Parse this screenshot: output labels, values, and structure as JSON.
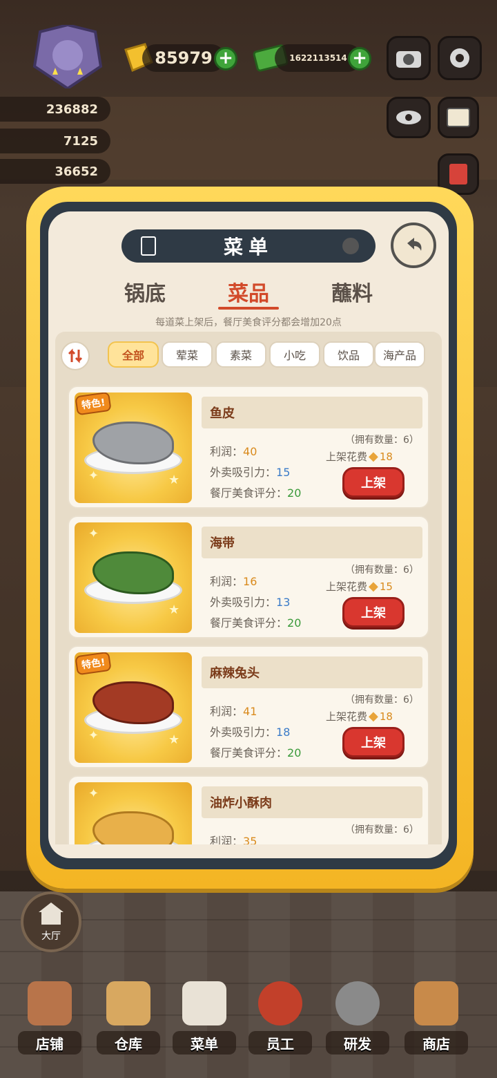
{
  "header": {
    "coins": "85979",
    "cash": "1622113514",
    "side_stats": [
      "236882",
      "7125",
      "36652"
    ]
  },
  "modal": {
    "title": "菜单",
    "main_tabs": [
      "锅底",
      "菜品",
      "蘸料"
    ],
    "active_main_tab": "菜品",
    "hint": "每道菜上架后，餐厅美食评分都会增加20点",
    "filters": [
      "全部",
      "荤菜",
      "素菜",
      "小吃",
      "饮品",
      "海产品"
    ],
    "active_filter": "全部",
    "items": [
      {
        "special_tag": "特色!",
        "name": "鱼皮",
        "profit_label": "利润：",
        "profit": "40",
        "appeal_label": "外卖吸引力：",
        "appeal": "15",
        "score_label": "餐厅美食评分：",
        "score": "20",
        "owned": "（拥有数量：6）",
        "cost_label": "上架花费",
        "cost": "18",
        "action": "上架"
      },
      {
        "special_tag": "",
        "name": "海带",
        "profit_label": "利润：",
        "profit": "16",
        "appeal_label": "外卖吸引力：",
        "appeal": "13",
        "score_label": "餐厅美食评分：",
        "score": "20",
        "owned": "（拥有数量：6）",
        "cost_label": "上架花费",
        "cost": "15",
        "action": "上架"
      },
      {
        "special_tag": "特色!",
        "name": "麻辣兔头",
        "profit_label": "利润：",
        "profit": "41",
        "appeal_label": "外卖吸引力：",
        "appeal": "18",
        "score_label": "餐厅美食评分：",
        "score": "20",
        "owned": "（拥有数量：6）",
        "cost_label": "上架花费",
        "cost": "18",
        "action": "上架"
      },
      {
        "special_tag": "",
        "name": "油炸小酥肉",
        "profit_label": "利润：",
        "profit": "35",
        "owned": "（拥有数量：6）"
      }
    ]
  },
  "hall_label": "大厅",
  "nav": [
    "店铺",
    "仓库",
    "菜单",
    "员工",
    "研发",
    "商店"
  ],
  "colors": {
    "accent": "#d24a2a",
    "modal_border": "#f4b524",
    "button_red": "#d9372f"
  }
}
